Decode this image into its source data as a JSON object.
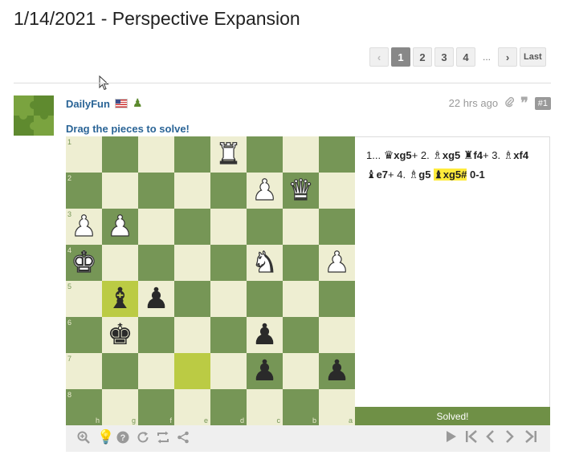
{
  "page": {
    "title": "1/14/2021 - Perspective Expansion"
  },
  "pagination": {
    "prev": "‹",
    "pages": [
      "1",
      "2",
      "3",
      "4"
    ],
    "current": "1",
    "ellipsis": "...",
    "next": "›",
    "last": "Last"
  },
  "post": {
    "username": "DailyFun",
    "time": "22 hrs ago",
    "post_number": "#1",
    "instruction": "Drag the pieces to solve!",
    "icons": [
      "flag-us-icon",
      "pawn-icon",
      "paperclip-icon",
      "quote-icon"
    ]
  },
  "board": {
    "ranks": [
      "1",
      "2",
      "3",
      "4",
      "5",
      "6",
      "7",
      "8"
    ],
    "files": [
      "h",
      "g",
      "f",
      "e",
      "d",
      "c",
      "b",
      "a"
    ],
    "pieces": [
      {
        "row": 0,
        "col": 4,
        "glyph": "♜",
        "color": "w",
        "name": "rook"
      },
      {
        "row": 1,
        "col": 5,
        "glyph": "♟",
        "color": "w",
        "name": "pawn"
      },
      {
        "row": 1,
        "col": 6,
        "glyph": "♛",
        "color": "w",
        "name": "queen"
      },
      {
        "row": 2,
        "col": 0,
        "glyph": "♟",
        "color": "w",
        "name": "pawn"
      },
      {
        "row": 2,
        "col": 1,
        "glyph": "♟",
        "color": "w",
        "name": "pawn"
      },
      {
        "row": 3,
        "col": 0,
        "glyph": "♚",
        "color": "w",
        "name": "king"
      },
      {
        "row": 3,
        "col": 5,
        "glyph": "♞",
        "color": "w",
        "name": "knight"
      },
      {
        "row": 3,
        "col": 7,
        "glyph": "♟",
        "color": "w",
        "name": "pawn"
      },
      {
        "row": 4,
        "col": 1,
        "glyph": "♝",
        "color": "b",
        "name": "bishop"
      },
      {
        "row": 4,
        "col": 2,
        "glyph": "♟",
        "color": "b",
        "name": "pawn"
      },
      {
        "row": 5,
        "col": 1,
        "glyph": "♚",
        "color": "b",
        "name": "king"
      },
      {
        "row": 5,
        "col": 5,
        "glyph": "♟",
        "color": "b",
        "name": "pawn"
      },
      {
        "row": 6,
        "col": 5,
        "glyph": "♟",
        "color": "b",
        "name": "pawn"
      },
      {
        "row": 6,
        "col": 7,
        "glyph": "♟",
        "color": "b",
        "name": "pawn"
      }
    ],
    "highlights": [
      {
        "row": 4,
        "col": 1
      },
      {
        "row": 6,
        "col": 3
      }
    ],
    "colors": {
      "light": "#eeeed2",
      "dark": "#769656",
      "highlight": "#bbcb44"
    }
  },
  "moves": {
    "line1": [
      {
        "t": "1... ",
        "b": false
      },
      {
        "t": "♛",
        "fig": true
      },
      {
        "t": "xg5",
        "b": true
      },
      {
        "t": "+ 2. ",
        "b": false
      },
      {
        "t": "♗",
        "fig": true
      },
      {
        "t": "xg5 ",
        "b": true
      },
      {
        "t": "♜",
        "fig": true
      },
      {
        "t": "f4",
        "b": true
      },
      {
        "t": "+ 3. ",
        "b": false
      },
      {
        "t": "♗",
        "fig": true
      },
      {
        "t": "xf4",
        "b": true
      }
    ],
    "line2": [
      {
        "t": "♝",
        "fig": true
      },
      {
        "t": "e7",
        "b": true
      },
      {
        "t": "+ 4. ",
        "b": false
      },
      {
        "t": "♗",
        "fig": true
      },
      {
        "t": "g5 ",
        "b": true
      },
      {
        "t": "♝xg5#",
        "b": true,
        "cur": true
      },
      {
        "t": " 0-1",
        "b": true
      }
    ]
  },
  "status": {
    "solved": "Solved!"
  },
  "toolbar": {
    "left": [
      "zoom-icon",
      "hint-icon",
      "help-icon",
      "reset-icon",
      "flip-icon",
      "share-icon"
    ],
    "right": [
      "play-icon",
      "first-icon",
      "prev-icon",
      "next-icon",
      "last-icon"
    ]
  }
}
